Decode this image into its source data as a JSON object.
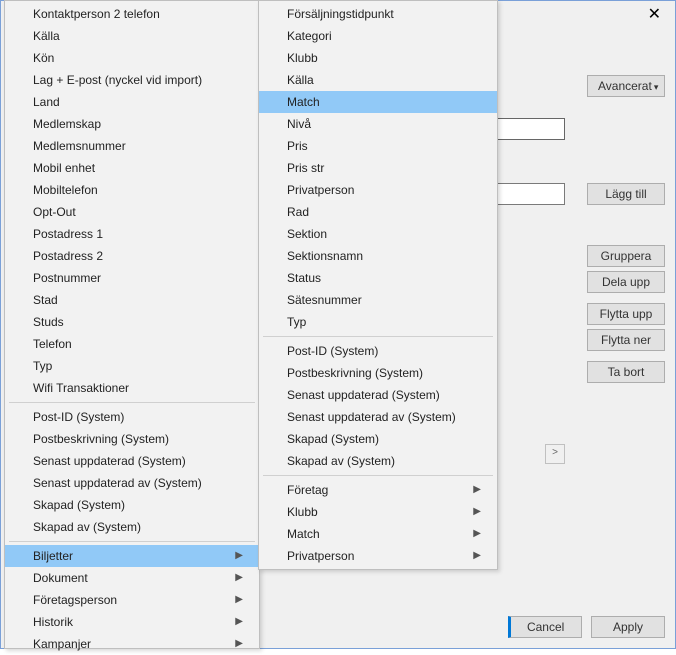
{
  "dialog": {
    "close_label": "✕",
    "advanced_label": "Avancerat",
    "add_label": "Lägg till",
    "group_label": "Gruppera",
    "split_label": "Dela upp",
    "moveup_label": "Flytta upp",
    "movedown_label": "Flytta ner",
    "remove_label": "Ta bort",
    "cancel_label": "Cancel",
    "apply_label": "Apply",
    "scroll_right_glyph": ">"
  },
  "menu1": {
    "items_top": [
      "Kontaktperson 2 telefon",
      "Källa",
      "Kön",
      "Lag + E-post (nyckel vid import)",
      "Land",
      "Medlemskap",
      "Medlemsnummer",
      "Mobil enhet",
      "Mobiltelefon",
      "Opt-Out",
      "Postadress 1",
      "Postadress 2",
      "Postnummer",
      "Stad",
      "Studs",
      "Telefon",
      "Typ",
      "Wifi Transaktioner"
    ],
    "items_sys": [
      "Post-ID (System)",
      "Postbeskrivning (System)",
      "Senast uppdaterad (System)",
      "Senast uppdaterad av (System)",
      "Skapad (System)",
      "Skapad av (System)"
    ],
    "items_sub": [
      "Biljetter",
      "Dokument",
      "Företagsperson",
      "Historik",
      "Kampanjer"
    ],
    "selected_sub_index": 0
  },
  "menu2": {
    "items_top": [
      "Försäljningstidpunkt",
      "Kategori",
      "Klubb",
      "Källa",
      "Match",
      "Nivå",
      "Pris",
      "Pris str",
      "Privatperson",
      "Rad",
      "Sektion",
      "Sektionsnamn",
      "Status",
      "Sätesnummer",
      "Typ"
    ],
    "selected_top_index": 4,
    "items_sys": [
      "Post-ID (System)",
      "Postbeskrivning (System)",
      "Senast uppdaterad (System)",
      "Senast uppdaterad av (System)",
      "Skapad (System)",
      "Skapad av (System)"
    ],
    "items_sub": [
      "Företag",
      "Klubb",
      "Match",
      "Privatperson"
    ]
  }
}
